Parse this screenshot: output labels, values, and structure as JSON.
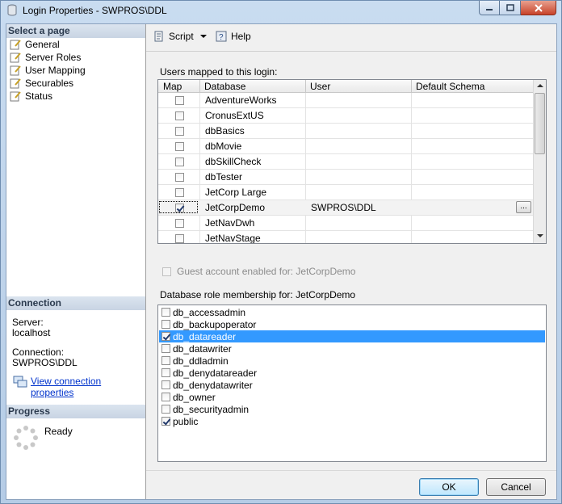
{
  "window": {
    "title": "Login Properties - SWPROS\\DDL"
  },
  "left": {
    "select_page_header": "Select a page",
    "pages": [
      {
        "label": "General"
      },
      {
        "label": "Server Roles"
      },
      {
        "label": "User Mapping"
      },
      {
        "label": "Securables"
      },
      {
        "label": "Status"
      }
    ],
    "connection_header": "Connection",
    "server_label": "Server:",
    "server_value": "localhost",
    "connection_label": "Connection:",
    "connection_value": "SWPROS\\DDL",
    "view_connection_link": "View connection properties",
    "progress_header": "Progress",
    "progress_status": "Ready"
  },
  "toolbar": {
    "script_label": "Script",
    "help_label": "Help"
  },
  "mapping": {
    "section_label": "Users mapped to this login:",
    "columns": [
      "Map",
      "Database",
      "User",
      "Default Schema"
    ],
    "rows": [
      {
        "map": false,
        "database": "AdventureWorks",
        "user": "",
        "schema": ""
      },
      {
        "map": false,
        "database": "CronusExtUS",
        "user": "",
        "schema": ""
      },
      {
        "map": false,
        "database": "dbBasics",
        "user": "",
        "schema": ""
      },
      {
        "map": false,
        "database": "dbMovie",
        "user": "",
        "schema": ""
      },
      {
        "map": false,
        "database": "dbSkillCheck",
        "user": "",
        "schema": ""
      },
      {
        "map": false,
        "database": "dbTester",
        "user": "",
        "schema": ""
      },
      {
        "map": false,
        "database": "JetCorp Large",
        "user": "",
        "schema": ""
      },
      {
        "map": true,
        "database": "JetCorpDemo",
        "user": "SWPROS\\DDL",
        "schema": "",
        "ellipsis": "..."
      },
      {
        "map": false,
        "database": "JetNavDwh",
        "user": "",
        "schema": ""
      },
      {
        "map": false,
        "database": "JetNavStage",
        "user": "",
        "schema": ""
      }
    ]
  },
  "guest": {
    "label": "Guest account enabled for: JetCorpDemo",
    "checked": false
  },
  "roles": {
    "section_label": "Database role membership for: JetCorpDemo",
    "items": [
      {
        "name": "db_accessadmin",
        "checked": false
      },
      {
        "name": "db_backupoperator",
        "checked": false
      },
      {
        "name": "db_datareader",
        "checked": true,
        "selected": true
      },
      {
        "name": "db_datawriter",
        "checked": false
      },
      {
        "name": "db_ddladmin",
        "checked": false
      },
      {
        "name": "db_denydatareader",
        "checked": false
      },
      {
        "name": "db_denydatawriter",
        "checked": false
      },
      {
        "name": "db_owner",
        "checked": false
      },
      {
        "name": "db_securityadmin",
        "checked": false
      },
      {
        "name": "public",
        "checked": true
      }
    ]
  },
  "buttons": {
    "ok": "OK",
    "cancel": "Cancel"
  }
}
